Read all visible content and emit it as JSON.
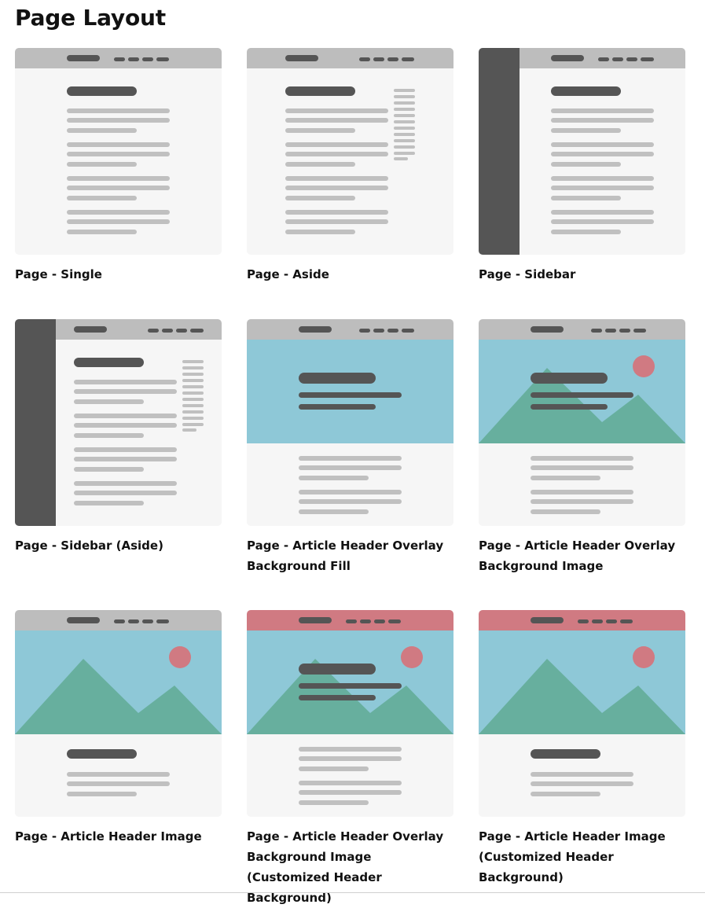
{
  "page": {
    "title": "Page Layout"
  },
  "colors": {
    "card_bg": "#f6f6f6",
    "header_bar": "#bdbdbd",
    "header_bar_custom": "#d07a82",
    "dark": "#555555",
    "line_light": "#c0c0c0",
    "sky": "#8ec8d7",
    "mountain": "#67af9e",
    "sun": "#d07a82"
  },
  "layouts": [
    {
      "label": "Page - Single",
      "icon": "layout-single-icon"
    },
    {
      "label": "Page - Aside",
      "icon": "layout-aside-icon"
    },
    {
      "label": "Page - Sidebar",
      "icon": "layout-sidebar-icon"
    },
    {
      "label": "Page - Sidebar (Aside)",
      "icon": "layout-sidebar-aside-icon"
    },
    {
      "label": "Page - Article Header Overlay Background Fill",
      "icon": "layout-header-overlay-fill-icon"
    },
    {
      "label": "Page - Article Header Overlay Background Image",
      "icon": "layout-header-overlay-image-icon"
    },
    {
      "label": "Page - Article Header Image",
      "icon": "layout-header-image-icon"
    },
    {
      "label": "Page - Article Header Overlay Background Image (Customized Header Background)",
      "icon": "layout-header-overlay-image-custom-icon"
    },
    {
      "label": "Page - Article Header Image (Customized Header Background)",
      "icon": "layout-header-image-custom-icon"
    }
  ]
}
